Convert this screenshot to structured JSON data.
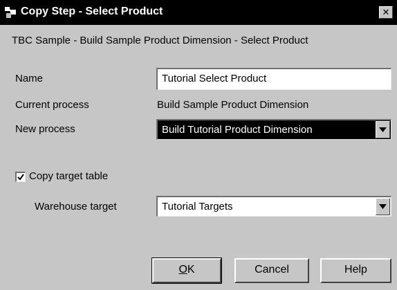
{
  "window": {
    "title": "Copy Step - Select Product",
    "close_glyph": "✕"
  },
  "subtitle": "TBC Sample - Build Sample Product Dimension - Select Product",
  "form": {
    "name_label": "Name",
    "name_value": "Tutorial Select Product",
    "current_process_label": "Current process",
    "current_process_value": "Build Sample Product Dimension",
    "new_process_label": "New process",
    "new_process_value": "Build Tutorial Product Dimension",
    "copy_target_label": "Copy target table",
    "copy_target_checked": true,
    "warehouse_target_label": "Warehouse target",
    "warehouse_target_value": "Tutorial Targets"
  },
  "buttons": {
    "ok_mnemonic": "O",
    "ok_rest": "K",
    "cancel": "Cancel",
    "help": "Help"
  },
  "colors": {
    "dialog_bg": "#c6c6c6",
    "titlebar_bg": "#000000",
    "selected_bg": "#000000"
  }
}
